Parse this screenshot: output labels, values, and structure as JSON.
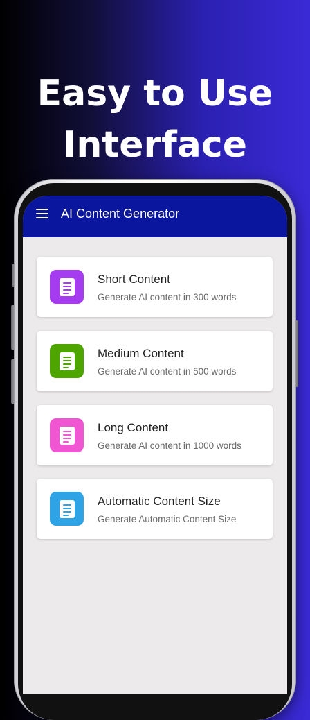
{
  "promo": {
    "headline_line1": "Easy to Use",
    "headline_line2": "Interface"
  },
  "app": {
    "title": "AI Content Generator",
    "menu_icon": "hamburger-menu-icon"
  },
  "cards": [
    {
      "title": "Short Content",
      "subtitle": "Generate AI content in 300 words",
      "icon": "document-icon",
      "color": "#a63cf0"
    },
    {
      "title": "Medium Content",
      "subtitle": "Generate AI content in 500 words",
      "icon": "document-icon",
      "color": "#4fa500"
    },
    {
      "title": "Long Content",
      "subtitle": "Generate AI content in 1000 words",
      "icon": "document-icon",
      "color": "#f056d2"
    },
    {
      "title": "Automatic Content Size",
      "subtitle": "Generate Automatic Content Size",
      "icon": "document-icon",
      "color": "#2ea4e6"
    }
  ]
}
